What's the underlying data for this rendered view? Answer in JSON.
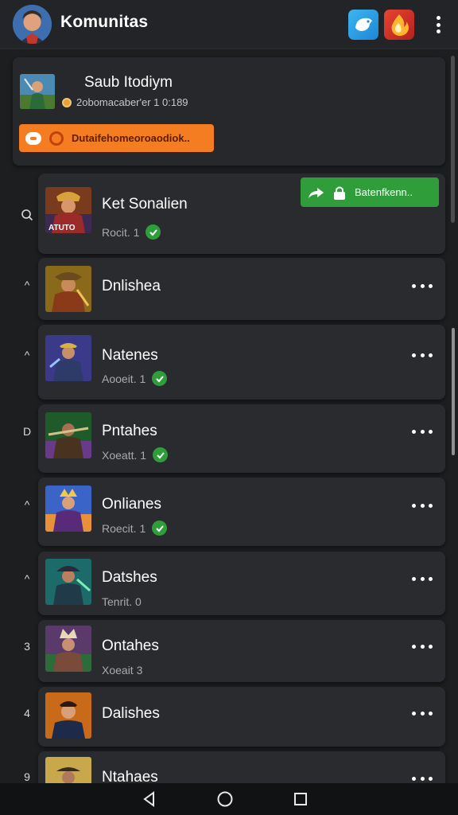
{
  "app_bar": {
    "title": "Komunitas",
    "icons": [
      "avatar",
      "bird-app-icon",
      "fire-app-icon",
      "more-vert-icon"
    ]
  },
  "profile": {
    "name": "Saub Itodiym",
    "meta": "2obomacaber'er 1 0:189",
    "cta_label": "Dutaifehomeoroaodiok..",
    "accent": "#f47c21"
  },
  "share_button": {
    "label": "Batenfkenn..",
    "color": "#2f9e3a"
  },
  "rows": [
    {
      "index": "Q",
      "title": "Ket Sonalien",
      "sub": "Rocit. 1",
      "verified": true,
      "art_label": "ATUTO"
    },
    {
      "index": "^",
      "title": "Dnlishea",
      "sub": "",
      "verified": false
    },
    {
      "index": "^",
      "title": "Natenes",
      "sub": "Aooeit. 1",
      "verified": true
    },
    {
      "index": "D",
      "title": "Pntahes",
      "sub": "Xoeatt. 1",
      "verified": true
    },
    {
      "index": "^",
      "title": "Onlianes",
      "sub": "Roecit. 1",
      "verified": true
    },
    {
      "index": "^",
      "title": "Datshes",
      "sub": "Tenrit. 0",
      "verified": false
    },
    {
      "index": "3",
      "title": "Ontahes",
      "sub": "Xoeait 3",
      "verified": false
    },
    {
      "index": "4",
      "title": "Dalishes",
      "sub": "",
      "verified": false
    },
    {
      "index": "9",
      "title": "Ntahaes",
      "sub": "",
      "verified": false
    }
  ],
  "nav": {
    "icons": [
      "back-icon",
      "home-icon",
      "recents-icon"
    ]
  }
}
